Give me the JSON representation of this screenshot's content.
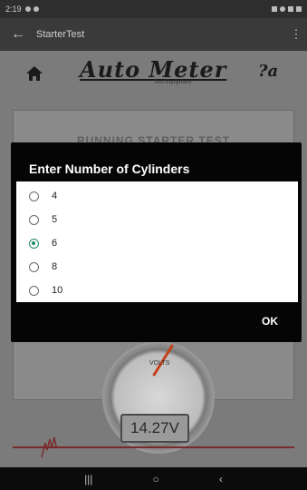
{
  "status_bar": {
    "time": "2:19"
  },
  "app_bar": {
    "back_icon": "arrow-left-icon",
    "title": "StarterTest",
    "menu_icon": "kebab-menu-icon"
  },
  "background": {
    "logo_text": "Auto Meter",
    "logo_subtext": "Test Equipment",
    "panel_title": "RUNNING STARTER TEST",
    "gauge_label": "VOLTS",
    "voltage": "14.27V"
  },
  "dialog": {
    "title": "Enter Number of Cylinders",
    "options": [
      "4",
      "5",
      "6",
      "8",
      "10"
    ],
    "selected": "6",
    "ok_label": "OK"
  },
  "colors": {
    "accent": "#1e8a6a",
    "dialog_bg": "#050505",
    "overlay_bg": "#7b7b7b"
  }
}
